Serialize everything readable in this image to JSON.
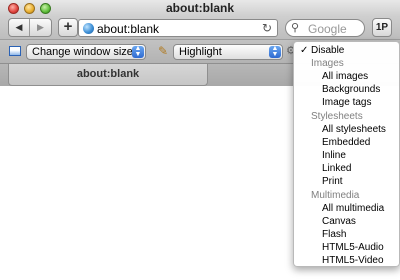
{
  "window": {
    "title": "about:blank"
  },
  "toolbar": {
    "address": "about:blank",
    "search_placeholder": "Google",
    "password_button_label": "1P",
    "add_button_label": "+"
  },
  "devbar": {
    "window_size_select": "Change window size",
    "highlight_select": "Highlight"
  },
  "tabs": [
    {
      "label": "about:blank"
    }
  ],
  "menu": {
    "checked_item": "Disable",
    "sections": [
      {
        "header": "Images",
        "items": [
          "All images",
          "Backgrounds",
          "Image tags"
        ]
      },
      {
        "header": "Stylesheets",
        "items": [
          "All stylesheets",
          "Embedded",
          "Inline",
          "Linked",
          "Print"
        ]
      },
      {
        "header": "Multimedia",
        "items": [
          "All multimedia",
          "Canvas",
          "Flash",
          "HTML5-Audio",
          "HTML5-Video"
        ]
      }
    ]
  },
  "icons": {
    "back": "chevron-left-icon",
    "forward": "chevron-right-icon",
    "site": "globe-icon",
    "reload": "reload-icon",
    "search": "search-icon",
    "window_size": "window-icon",
    "highlight": "pencil-icon",
    "settings": "gear-icon"
  }
}
